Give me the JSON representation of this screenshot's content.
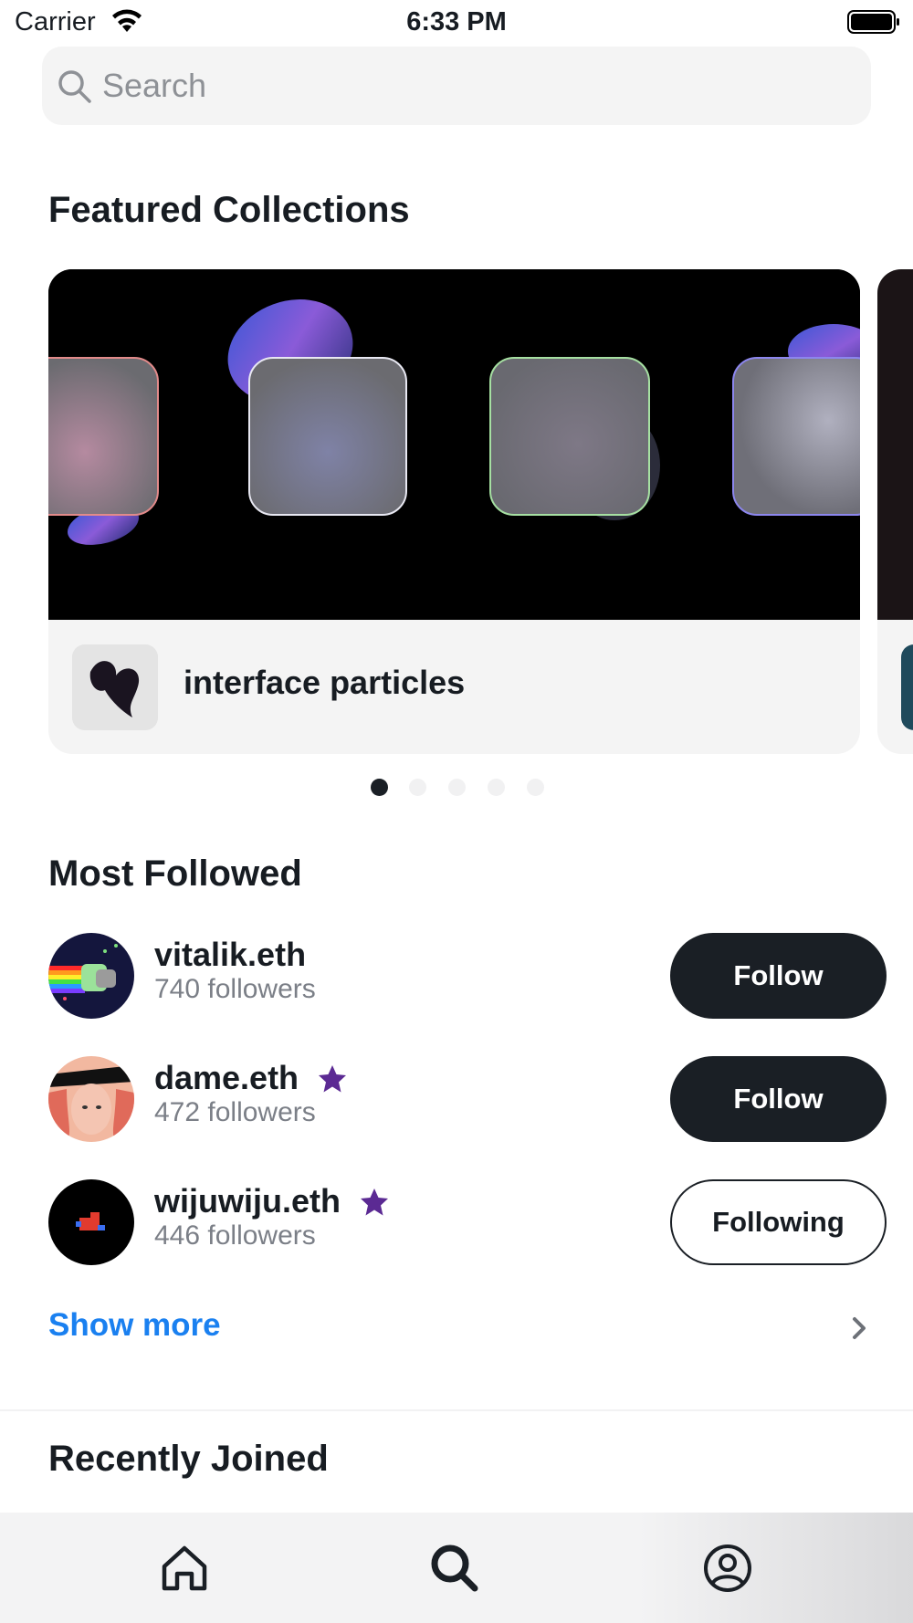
{
  "status_bar": {
    "carrier": "Carrier",
    "time": "6:33 PM",
    "icons": [
      "wifi-icon",
      "battery-icon"
    ]
  },
  "search": {
    "placeholder": "Search",
    "value": "",
    "icon": "search-icon"
  },
  "featured": {
    "title": "Featured Collections",
    "collections": [
      {
        "name": "interface particles"
      }
    ],
    "page_count": 5,
    "active_page": 1
  },
  "most_followed": {
    "title": "Most Followed",
    "users": [
      {
        "name": "vitalik.eth",
        "followers": "740 followers",
        "verified": false,
        "button": "Follow",
        "following": false
      },
      {
        "name": "dame.eth",
        "followers": "472 followers",
        "verified": true,
        "button": "Follow",
        "following": false
      },
      {
        "name": "wijuwiju.eth",
        "followers": "446 followers",
        "verified": true,
        "button": "Following",
        "following": true
      }
    ],
    "show_more": "Show more"
  },
  "recently_joined": {
    "title": "Recently Joined"
  },
  "tabbar": {
    "tabs": [
      {
        "icon": "home-icon",
        "active": false
      },
      {
        "icon": "search-icon",
        "active": true
      },
      {
        "icon": "profile-icon",
        "active": false
      }
    ]
  },
  "colors": {
    "text": "#171c22",
    "muted": "#7b7f87",
    "accent": "#1a80f0",
    "button_dark": "#1a1f25",
    "star": "#5b2a93"
  }
}
